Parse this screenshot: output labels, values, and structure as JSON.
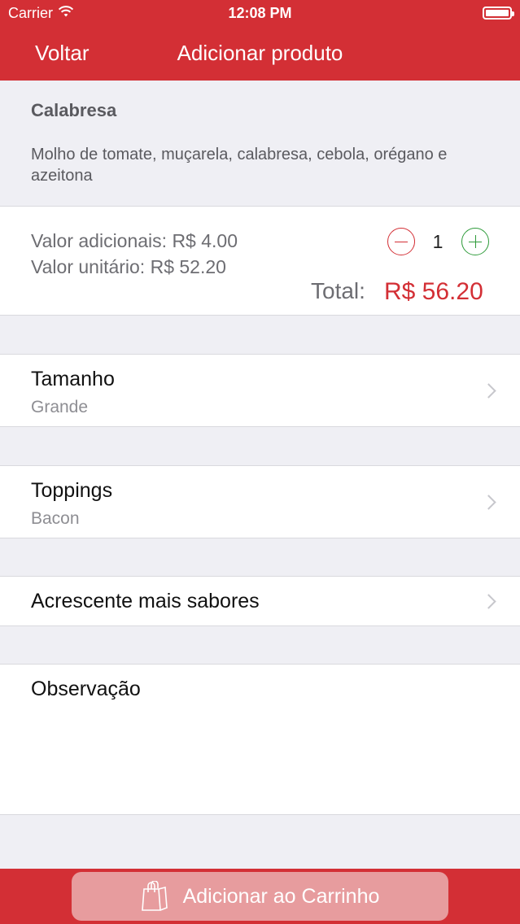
{
  "status_bar": {
    "carrier": "Carrier",
    "time": "12:08 PM"
  },
  "nav": {
    "back_label": "Voltar",
    "title": "Adicionar produto"
  },
  "product": {
    "name": "Calabresa",
    "description": "Molho de tomate, muçarela, calabresa, cebola, orégano e azeitona"
  },
  "pricing": {
    "addons_line": "Valor adicionais: R$ 4.00",
    "unit_line": "Valor unitário: R$ 52.20",
    "quantity": "1",
    "total_label": "Total:",
    "total_value": "R$ 56.20"
  },
  "options": {
    "size": {
      "title": "Tamanho",
      "value": "Grande"
    },
    "toppings": {
      "title": "Toppings",
      "value": "Bacon"
    },
    "flavors": {
      "title": "Acrescente mais sabores"
    },
    "notes": {
      "title": "Observação"
    }
  },
  "footer": {
    "cart_button_label": "Adicionar ao Carrinho"
  },
  "colors": {
    "brand_red": "#d32f35",
    "plus_green": "#2e9b3a",
    "button_disabled": "#e79c9e"
  },
  "icons": {
    "wifi": "wifi-icon",
    "battery": "battery-icon",
    "minus": "minus-circle-icon",
    "plus": "plus-circle-icon",
    "chevron": "chevron-right-icon",
    "bag": "shopping-bag-icon"
  }
}
